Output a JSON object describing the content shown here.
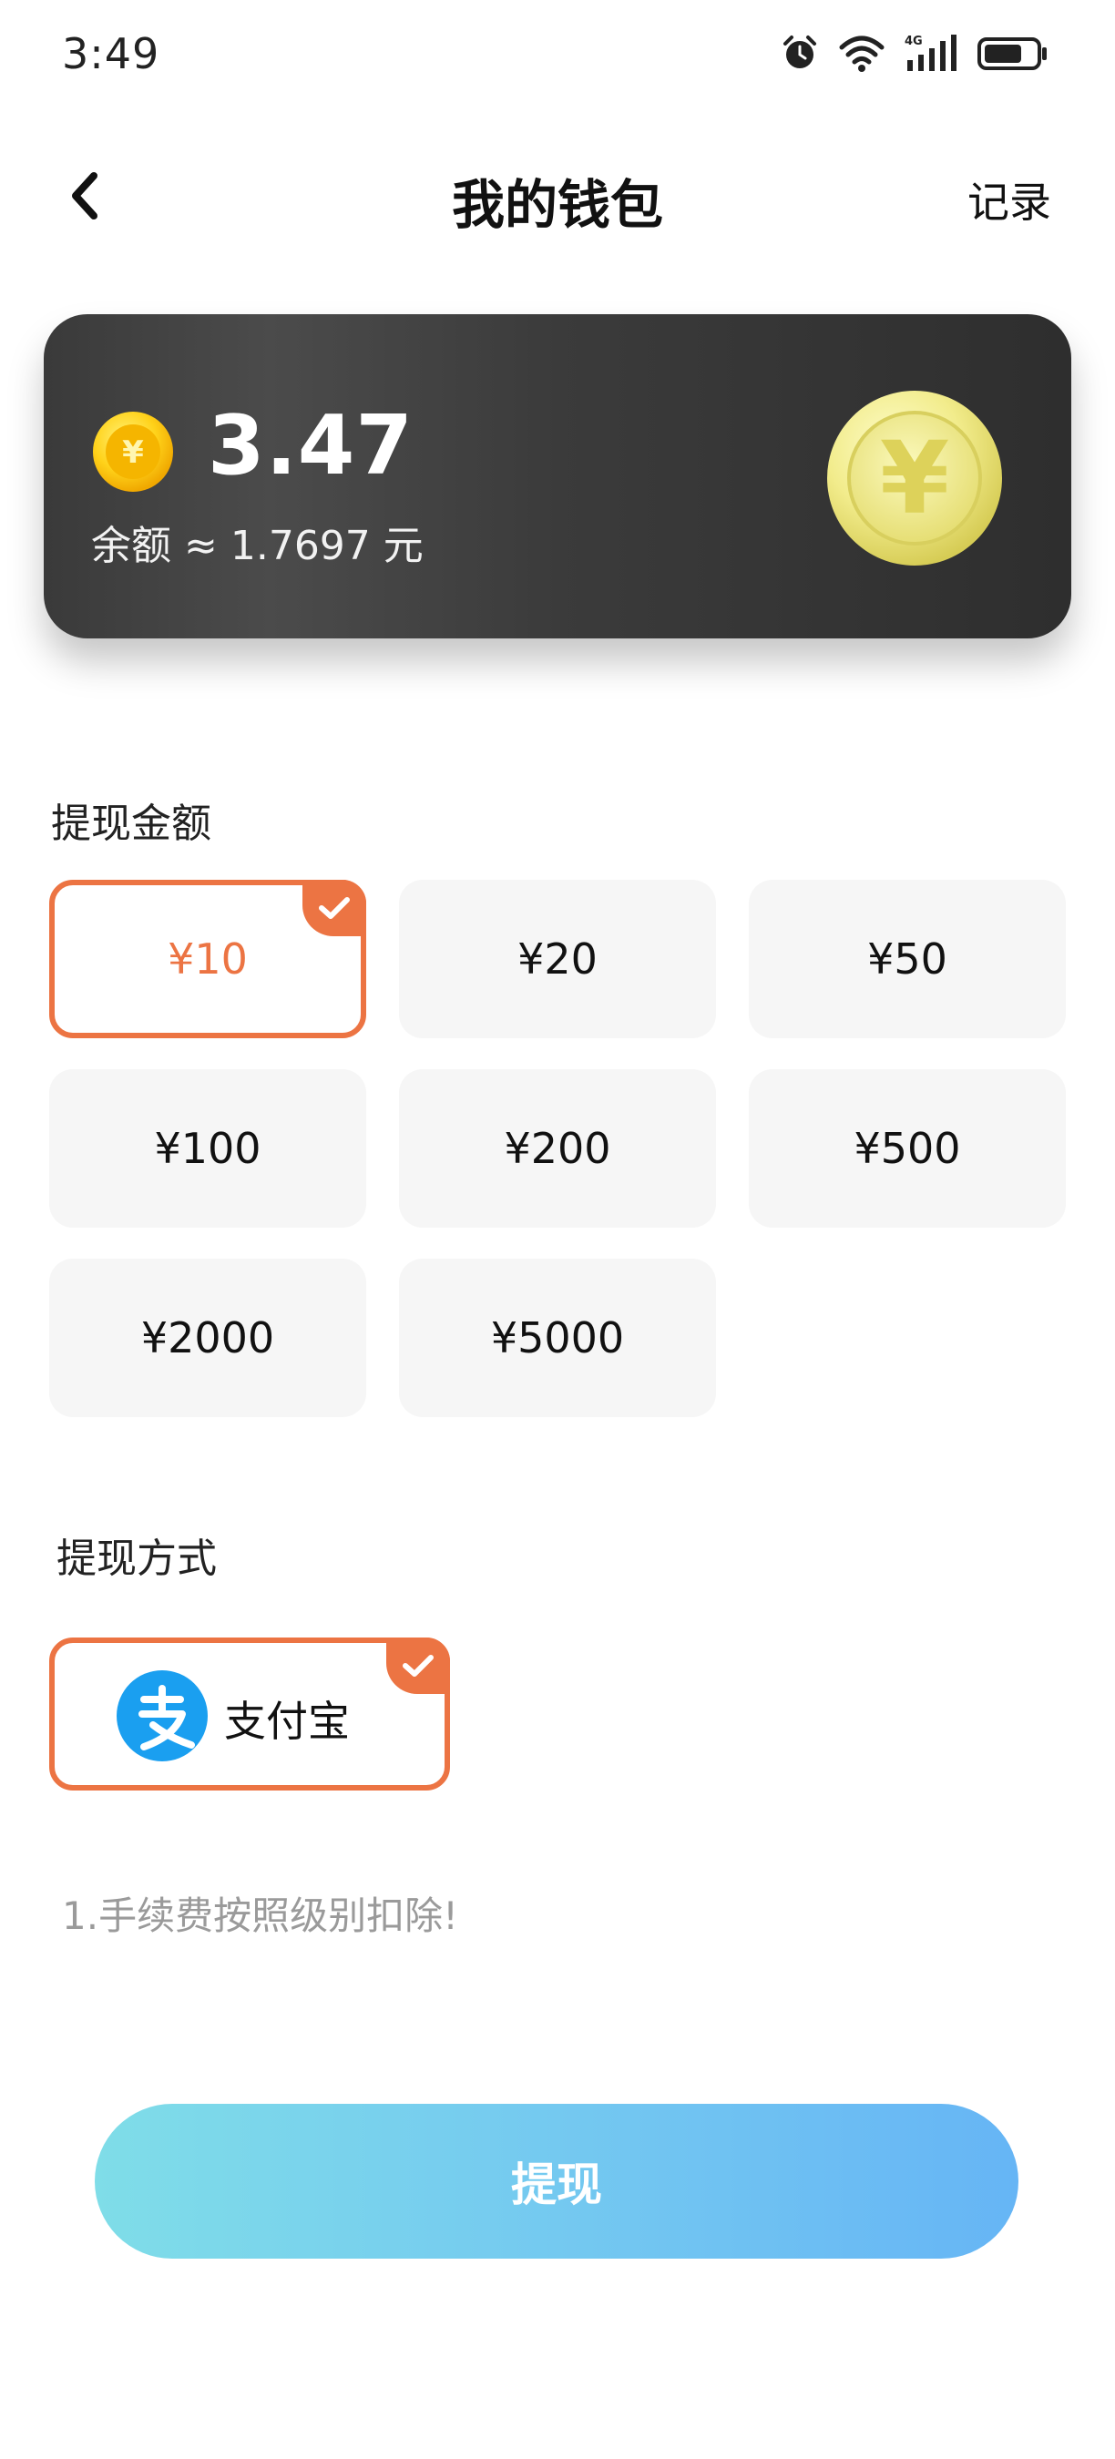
{
  "status": {
    "time": "3:49",
    "network": "4G"
  },
  "header": {
    "title": "我的钱包",
    "record": "记录"
  },
  "balance": {
    "value": "3.47",
    "approx": "余额 ≈ 1.7697 元",
    "coin_symbol": "¥"
  },
  "amount_section": {
    "label": "提现金额",
    "options": [
      "¥10",
      "¥20",
      "¥50",
      "¥100",
      "¥200",
      "¥500",
      "¥2000",
      "¥5000"
    ],
    "selected": "¥10"
  },
  "method_section": {
    "label": "提现方式",
    "methods": [
      {
        "name": "支付宝",
        "icon": "alipay-icon",
        "selected": true
      }
    ]
  },
  "note": "1.手续费按照级别扣除!",
  "submit_label": "提现",
  "colors": {
    "accent": "#ec7443",
    "alipay": "#1a9ff0",
    "button_start": "#7fdde8",
    "button_end": "#66b5f5",
    "card": "#3a3a3a"
  }
}
